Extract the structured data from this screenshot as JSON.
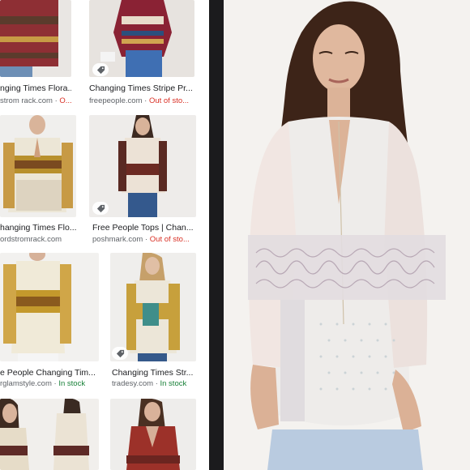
{
  "results": [
    {
      "title": "nging Times Flora...",
      "source": "strom rack.com",
      "sep": "·",
      "stock": "O...",
      "stock_type": "out"
    },
    {
      "title": "Changing Times Stripe Pr...",
      "source": "freepeople.com",
      "sep": "·",
      "stock": "Out of sto...",
      "stock_type": "out"
    },
    {
      "title": "hanging Times Flo...",
      "source": "ordstromrack.com",
      "sep": "",
      "stock": "",
      "stock_type": ""
    },
    {
      "title": "Free People Tops | Chan...",
      "source": "poshmark.com",
      "sep": "·",
      "stock": "Out of sto...",
      "stock_type": "out"
    },
    {
      "title": "e People Changing Tim...",
      "source": "rglamstyle.com",
      "sep": "·",
      "stock": "In stock",
      "stock_type": "in"
    },
    {
      "title": "Changing Times Str...",
      "source": "tradesy.com",
      "sep": "·",
      "stock": "In stock",
      "stock_type": "in"
    }
  ],
  "icons": {
    "badge": "price-tag-icon"
  },
  "colors": {
    "out_of_stock": "#d93025",
    "in_stock": "#188038",
    "divider": "#1b1b1d"
  }
}
